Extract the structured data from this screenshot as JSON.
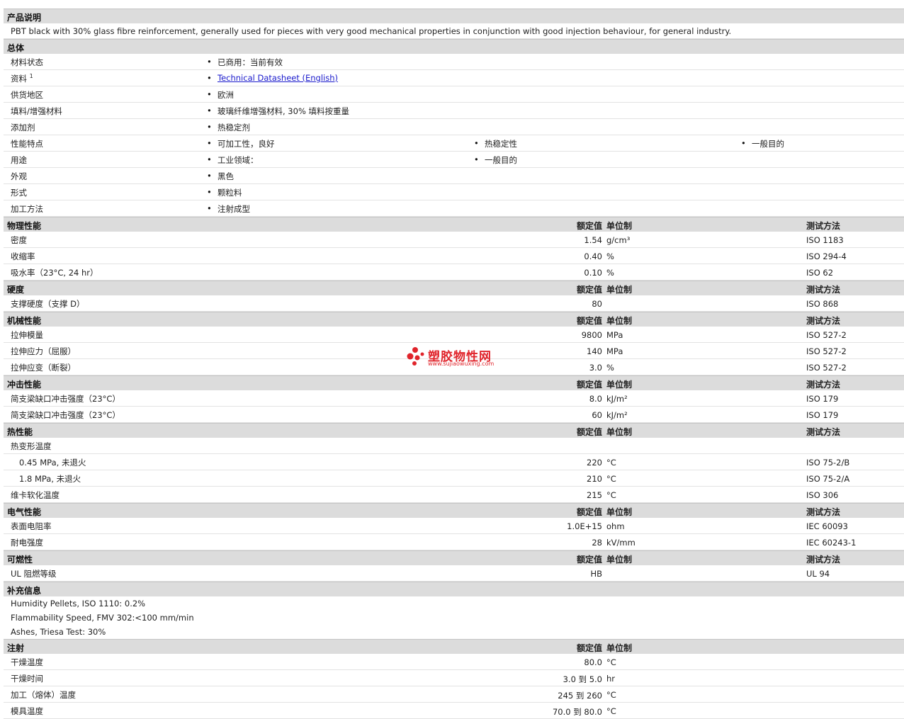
{
  "unit_header_value": "额定值",
  "unit_header_unit": "单位制",
  "unit_header_method": "测试方法",
  "product_description": {
    "title": "产品说明",
    "text": "PBT black with 30% glass fibre reinforcement, generally used for pieces with very good mechanical properties in conjunction with good injection behaviour, for general industry."
  },
  "general": {
    "title": "总体",
    "rows": [
      {
        "label": "材料状态",
        "b1": "已商用：当前有效"
      },
      {
        "label": "资料",
        "sup": "1",
        "link": "Technical Datasheet (English)"
      },
      {
        "label": "供货地区",
        "b1": "欧洲"
      },
      {
        "label": "填料/增强材料",
        "b1": "玻璃纤维增强材料, 30% 填料按重量"
      },
      {
        "label": "添加剂",
        "b1": "热稳定剂"
      },
      {
        "label": "性能特点",
        "b1": "可加工性，良好",
        "b2": "热稳定性",
        "b3": "一般目的"
      },
      {
        "label": "用途",
        "b1": "工业领域：",
        "b2": "一般目的"
      },
      {
        "label": "外观",
        "b1": "黑色"
      },
      {
        "label": "形式",
        "b1": "颗粒料"
      },
      {
        "label": "加工方法",
        "b1": "注射成型"
      }
    ]
  },
  "physical": {
    "title": "物理性能",
    "rows": [
      {
        "label": "密度",
        "value": "1.54",
        "unit": "g/cm³",
        "method": "ISO 1183"
      },
      {
        "label": "收缩率",
        "value": "0.40",
        "unit": "%",
        "method": "ISO 294-4"
      },
      {
        "label": "吸水率（23°C, 24 hr）",
        "value": "0.10",
        "unit": "%",
        "method": "ISO 62"
      }
    ]
  },
  "hardness": {
    "title": "硬度",
    "rows": [
      {
        "label": "支撑硬度（支撑 D）",
        "value": "80",
        "unit": "",
        "method": "ISO 868"
      }
    ]
  },
  "mechanical": {
    "title": "机械性能",
    "rows": [
      {
        "label": "拉伸模量",
        "value": "9800",
        "unit": "MPa",
        "method": "ISO 527-2"
      },
      {
        "label": "拉伸应力（屈服）",
        "value": "140",
        "unit": "MPa",
        "method": "ISO 527-2"
      },
      {
        "label": "拉伸应变（断裂）",
        "value": "3.0",
        "unit": "%",
        "method": "ISO 527-2"
      }
    ]
  },
  "impact": {
    "title": "冲击性能",
    "rows": [
      {
        "label": "简支梁缺口冲击强度（23°C）",
        "value": "8.0",
        "unit": "kJ/m²",
        "method": "ISO 179"
      },
      {
        "label": "简支梁缺口冲击强度（23°C）",
        "value": "60",
        "unit": "kJ/m²",
        "method": "ISO 179"
      }
    ]
  },
  "thermal": {
    "title": "热性能",
    "rows": [
      {
        "label": "热变形温度",
        "value": "",
        "unit": "",
        "method": ""
      },
      {
        "label": "0.45 MPa, 未退火",
        "indent": true,
        "value": "220",
        "unit": "°C",
        "method": "ISO 75-2/B"
      },
      {
        "label": "1.8 MPa, 未退火",
        "indent": true,
        "value": "210",
        "unit": "°C",
        "method": "ISO 75-2/A"
      },
      {
        "label": "维卡软化温度",
        "value": "215",
        "unit": "°C",
        "method": "ISO 306"
      }
    ]
  },
  "electrical": {
    "title": "电气性能",
    "rows": [
      {
        "label": "表面电阻率",
        "value": "1.0E+15",
        "unit": "ohm",
        "method": "IEC 60093"
      },
      {
        "label": "耐电强度",
        "value": "28",
        "unit": "kV/mm",
        "method": "IEC 60243-1"
      }
    ]
  },
  "flammability": {
    "title": "可燃性",
    "rows": [
      {
        "label": "UL 阻燃等级",
        "value": "HB",
        "unit": "",
        "method": "UL 94"
      }
    ]
  },
  "supplementary": {
    "title": "补充信息",
    "notes": [
      "Humidity Pellets, ISO 1110: 0.2%",
      "Flammability Speed, FMV 302:<100 mm/min",
      "Ashes, Triesa Test: 30%"
    ]
  },
  "injection": {
    "title": "注射",
    "rows": [
      {
        "label": "干燥温度",
        "value": "80.0",
        "unit": "°C",
        "method": ""
      },
      {
        "label": "干燥时间",
        "value": "3.0 到  5.0",
        "unit": "hr",
        "method": ""
      },
      {
        "label": "加工（熔体）温度",
        "value": "245 到  260",
        "unit": "°C",
        "method": ""
      },
      {
        "label": "模具温度",
        "value": "70.0 到  80.0",
        "unit": "°C",
        "method": ""
      }
    ]
  },
  "watermark": {
    "name": "塑胶物性网",
    "url": "www.sujiaowuxing.com",
    "color": "#e0242b"
  }
}
